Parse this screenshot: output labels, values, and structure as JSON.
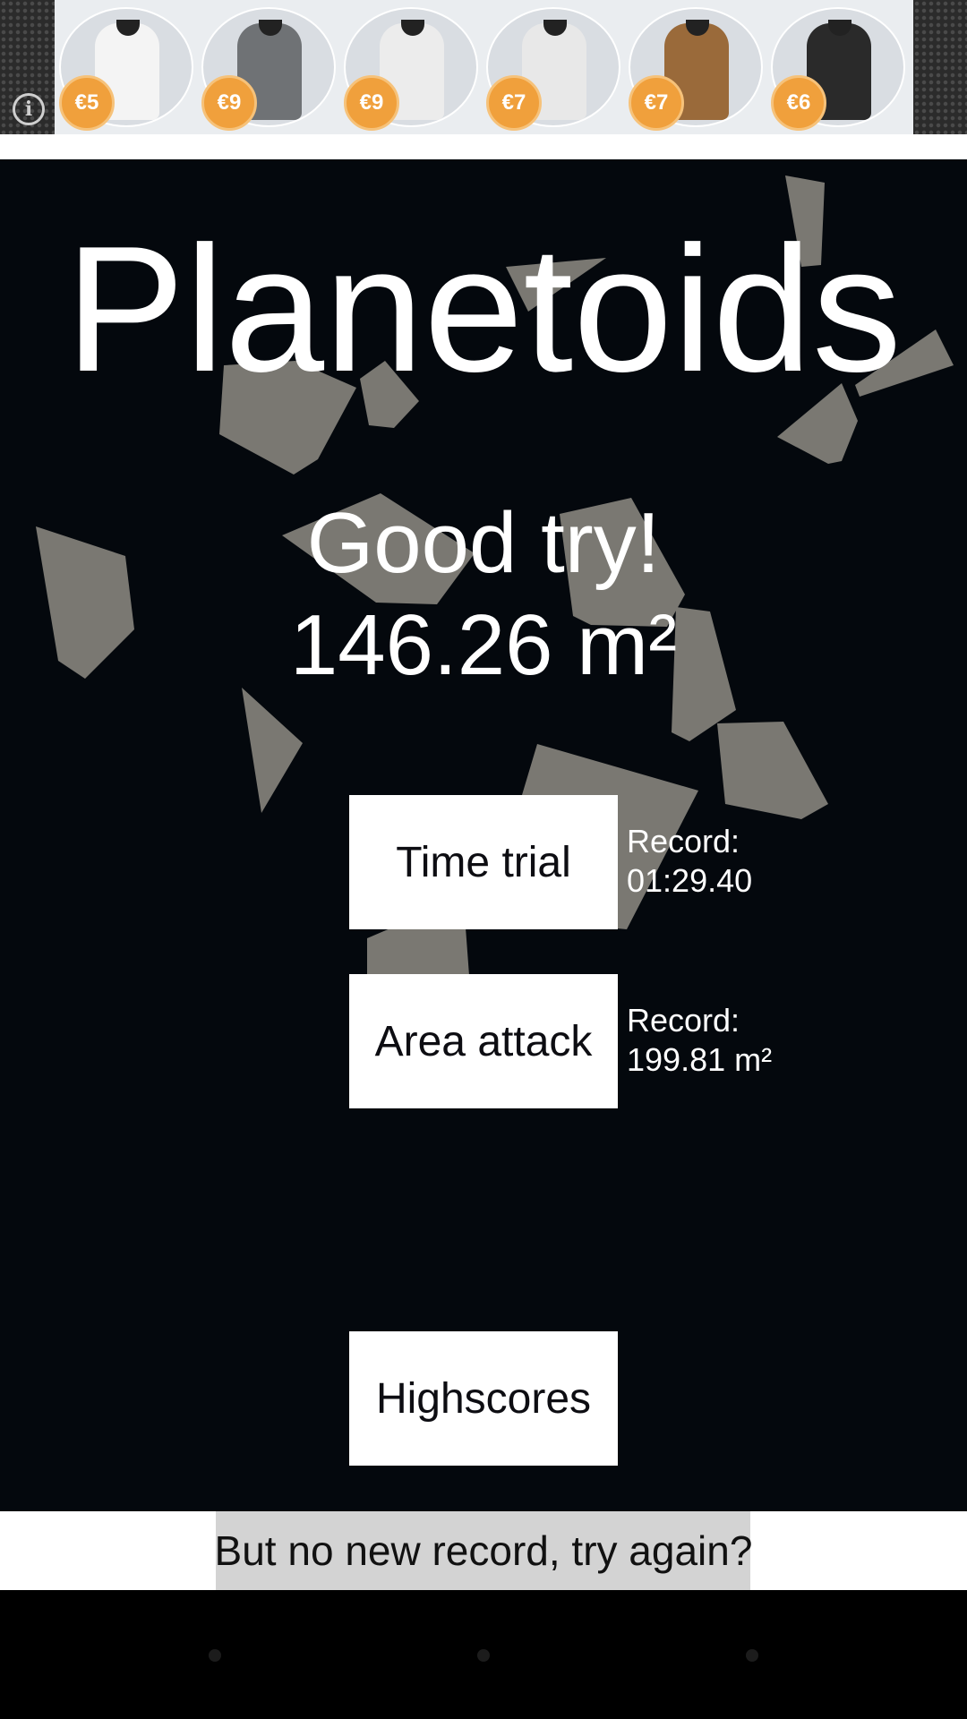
{
  "ad": {
    "info_icon": "info-icon",
    "items": [
      {
        "price": "€5",
        "shirt_color": "#f4f4f4"
      },
      {
        "price": "€9",
        "shirt_color": "#6f7275"
      },
      {
        "price": "€9",
        "shirt_color": "#ececec"
      },
      {
        "price": "€7",
        "shirt_color": "#e8e8e8"
      },
      {
        "price": "€7",
        "shirt_color": "#9a6a3a"
      },
      {
        "price": "€6",
        "shirt_color": "#2a2a2a"
      }
    ],
    "price_color": "#f0a03c"
  },
  "game": {
    "title": "Planetoids",
    "result_message": "Good try!",
    "score": "146.26 m²",
    "buttons": {
      "time_trial": "Time trial",
      "area_attack": "Area attack",
      "highscores": "Highscores"
    },
    "records": {
      "time_trial_label": "Record:",
      "time_trial_value": "01:29.40",
      "area_attack_label": "Record:",
      "area_attack_value": "199.81 m²"
    },
    "colors": {
      "background": "#04080d",
      "asteroid": "#7a7872",
      "text": "#ffffff"
    }
  },
  "footer": {
    "message": "But no new record, try again?"
  }
}
